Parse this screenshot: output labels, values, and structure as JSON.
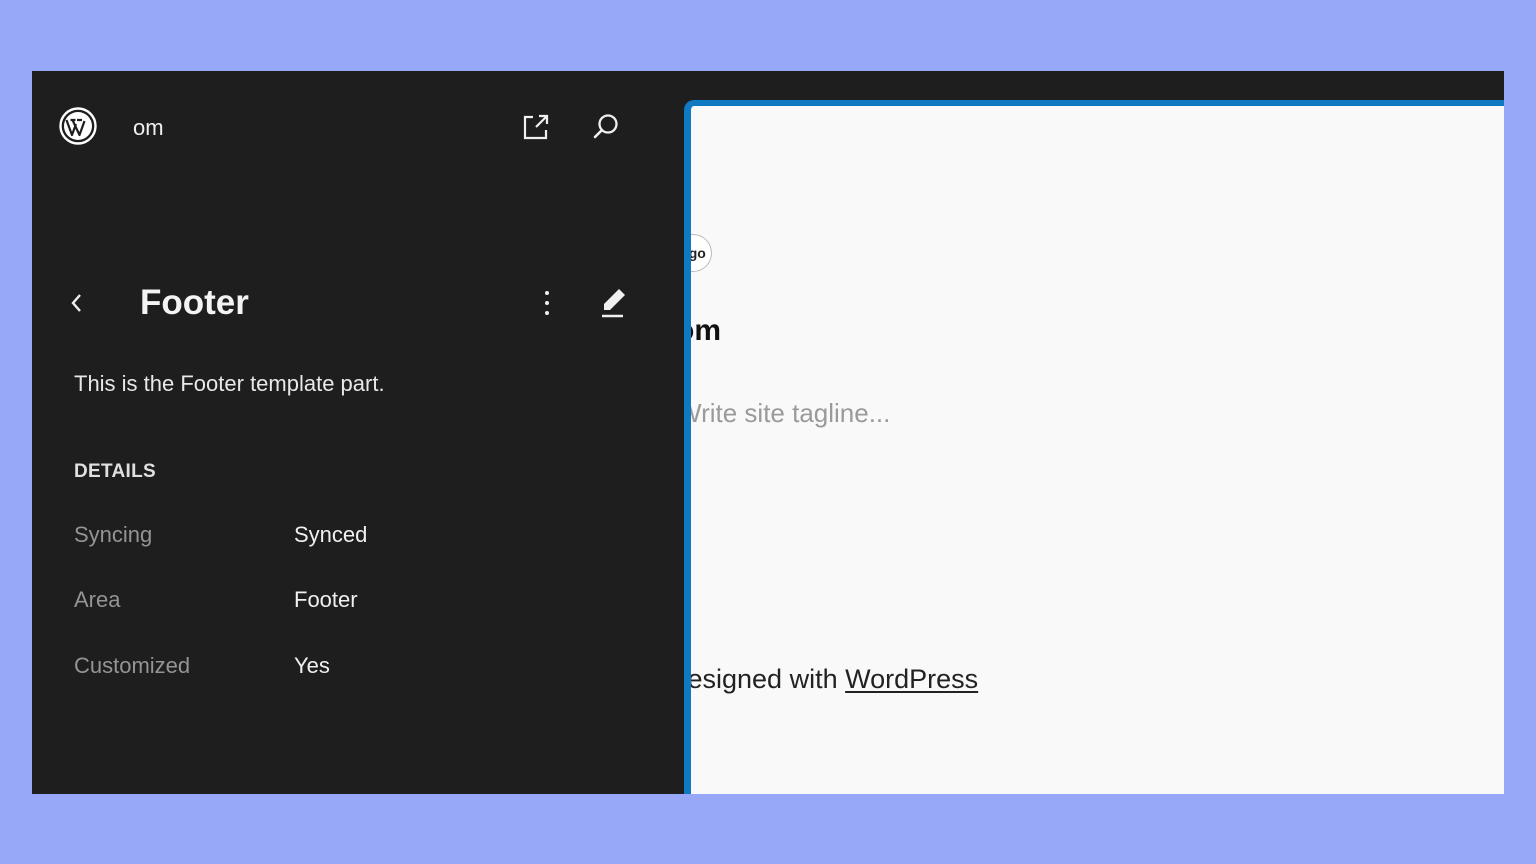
{
  "header": {
    "site_title": "om",
    "icons": [
      "wordpress-logo-icon",
      "external-link-icon",
      "search-icon"
    ]
  },
  "panel": {
    "title": "Footer",
    "description": "This is the Footer template part.",
    "details_heading": "DETAILS",
    "details": [
      {
        "label": "Syncing",
        "value": "Synced"
      },
      {
        "label": "Area",
        "value": "Footer"
      },
      {
        "label": "Customized",
        "value": "Yes"
      }
    ],
    "icons": [
      "chevron-left-icon",
      "more-vertical-icon",
      "pencil-icon"
    ]
  },
  "preview": {
    "logo_text": "ogo",
    "site_title": "om",
    "tagline": "Write site tagline...",
    "credit_prefix": "Designed with ",
    "credit_link": "WordPress"
  },
  "colors": {
    "background": "#97a8f8",
    "sidebar": "#1e1e1e",
    "accent": "#0f7ac2",
    "preview_bg": "#f9f9f9"
  }
}
